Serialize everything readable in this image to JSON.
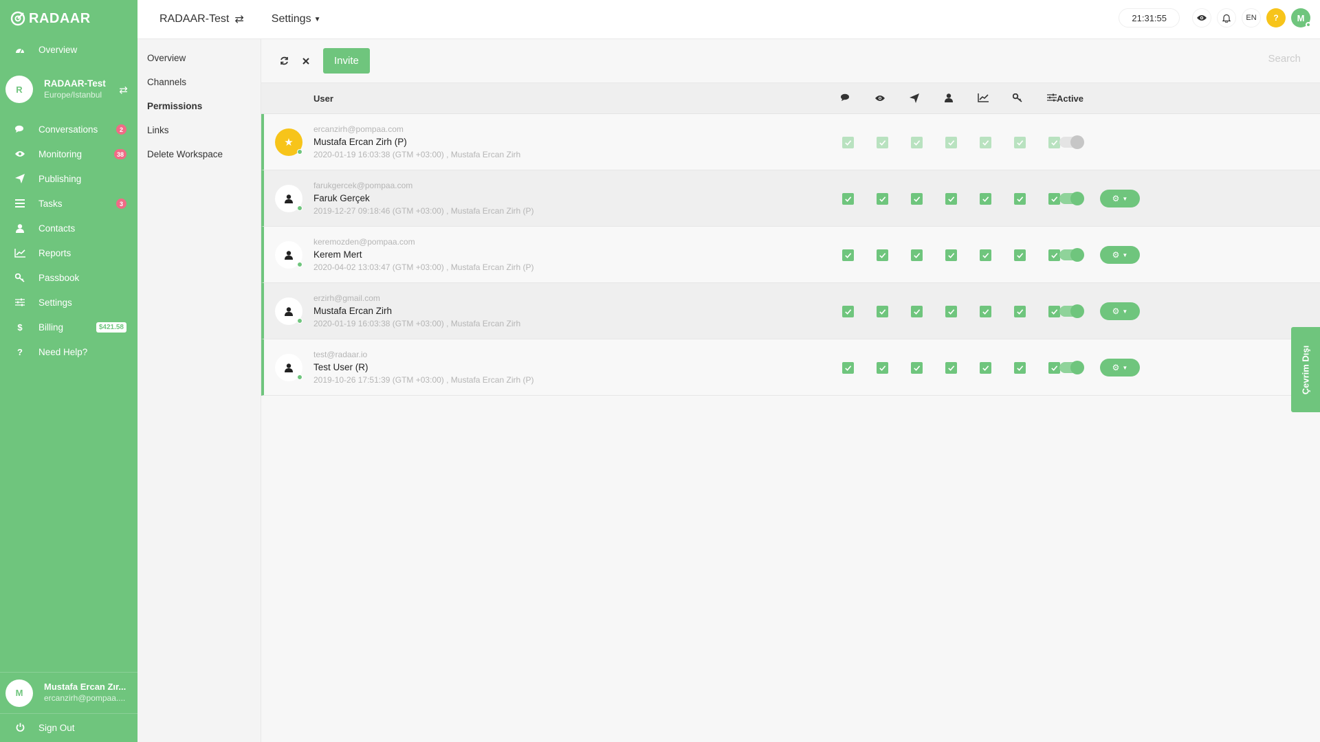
{
  "brand": {
    "name": "RADAAR"
  },
  "sidebar": {
    "items": [
      {
        "label": "Overview",
        "icon": "dashboard-icon"
      },
      {
        "label": "Conversations",
        "icon": "chat-icon",
        "badge": "2"
      },
      {
        "label": "Monitoring",
        "icon": "eye-icon",
        "badge": "38"
      },
      {
        "label": "Publishing",
        "icon": "send-icon"
      },
      {
        "label": "Tasks",
        "icon": "list-icon",
        "badge": "3"
      },
      {
        "label": "Contacts",
        "icon": "user-icon"
      },
      {
        "label": "Reports",
        "icon": "chart-icon"
      },
      {
        "label": "Passbook",
        "icon": "key-icon"
      },
      {
        "label": "Settings",
        "icon": "sliders-icon"
      },
      {
        "label": "Billing",
        "icon": "dollar-icon",
        "badge": "$421.58"
      },
      {
        "label": "Need Help?",
        "icon": "question-icon"
      }
    ],
    "workspace": {
      "initial": "R",
      "name": "RADAAR-Test",
      "timezone": "Europe/Istanbul"
    },
    "user": {
      "initial": "M",
      "name": "Mustafa Ercan Zır...",
      "email": "ercanzirh@pompaa...."
    },
    "signout_label": "Sign Out"
  },
  "topbar": {
    "workspace_label": "RADAAR-Test",
    "settings_label": "Settings",
    "clock": "21:31:55",
    "lang": "EN",
    "help": "?",
    "avatar_initial": "M"
  },
  "subnav": {
    "items": [
      "Overview",
      "Channels",
      "Permissions",
      "Links",
      "Delete Workspace"
    ],
    "active": "Permissions"
  },
  "toolbar": {
    "invite_label": "Invite",
    "search_placeholder": "Search"
  },
  "table": {
    "header_user": "User",
    "header_active": "Active",
    "permission_icons": [
      "chat-icon",
      "eye-icon",
      "send-icon",
      "user-icon",
      "chart-icon",
      "key-icon",
      "sliders-icon"
    ],
    "rows": [
      {
        "email": "ercanzirh@pompaa.com",
        "name": "Mustafa Ercan Zirh (P)",
        "meta": "2020-01-19 16:03:38 (GTM +03:00) , Mustafa Ercan Zirh",
        "owner": true,
        "active": false,
        "permissions": [
          true,
          true,
          true,
          true,
          true,
          true,
          true
        ]
      },
      {
        "email": "farukgercek@pompaa.com",
        "name": "Faruk Gerçek",
        "meta": "2019-12-27 09:18:46 (GTM +03:00) , Mustafa Ercan Zirh (P)",
        "owner": false,
        "active": true,
        "permissions": [
          true,
          true,
          true,
          true,
          true,
          true,
          true
        ]
      },
      {
        "email": "keremozden@pompaa.com",
        "name": "Kerem Mert",
        "meta": "2020-04-02 13:03:47 (GTM +03:00) , Mustafa Ercan Zirh (P)",
        "owner": false,
        "active": true,
        "permissions": [
          true,
          true,
          true,
          true,
          true,
          true,
          true
        ]
      },
      {
        "email": "erzirh@gmail.com",
        "name": "Mustafa Ercan Zirh",
        "meta": "2020-01-19 16:03:38 (GTM +03:00) , Mustafa Ercan Zirh",
        "owner": false,
        "active": true,
        "permissions": [
          true,
          true,
          true,
          true,
          true,
          true,
          true
        ]
      },
      {
        "email": "test@radaar.io",
        "name": "Test User (R)",
        "meta": "2019-10-26 17:51:39 (GTM +03:00) , Mustafa Ercan Zirh (P)",
        "owner": false,
        "active": true,
        "permissions": [
          true,
          true,
          true,
          true,
          true,
          true,
          true
        ]
      }
    ]
  },
  "offline_tab": "Çevrim Dışı",
  "colors": {
    "accent": "#6fc57d",
    "badge": "#f06b86",
    "help": "#f7c41a"
  }
}
